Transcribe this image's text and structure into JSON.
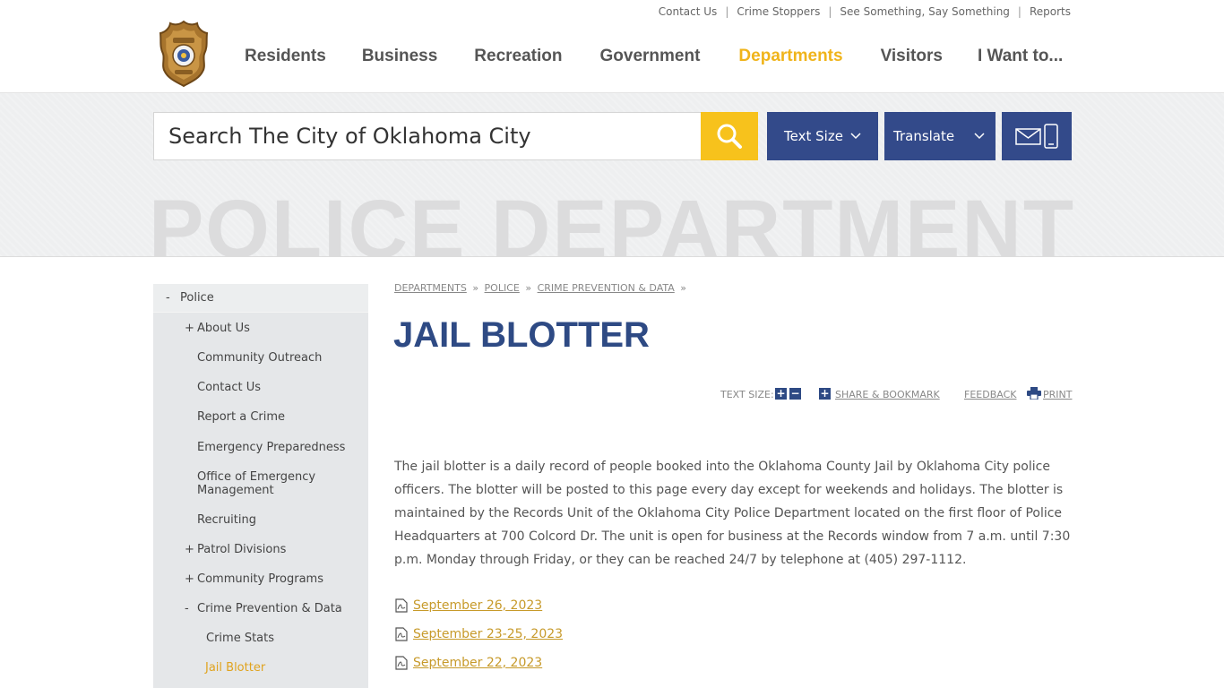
{
  "utility_nav": [
    "Contact Us",
    "Crime Stoppers",
    "See Something, Say Something",
    "Reports"
  ],
  "utility_sep": "|",
  "main_nav": [
    {
      "label": "Residents"
    },
    {
      "label": "Business"
    },
    {
      "label": "Recreation"
    },
    {
      "label": "Government"
    },
    {
      "label": "Departments",
      "active": true
    },
    {
      "label": "Visitors"
    },
    {
      "label": "I Want to..."
    }
  ],
  "search": {
    "placeholder": "Search The City of Oklahoma City"
  },
  "buttons": {
    "text_size": "Text Size",
    "translate": "Translate"
  },
  "banner_title": "POLICE DEPARTMENT",
  "sidebar": {
    "top": {
      "marker": "-",
      "label": "Police"
    },
    "items": [
      {
        "marker": "+",
        "label": "About Us"
      },
      {
        "marker": "",
        "label": "Community Outreach"
      },
      {
        "marker": "",
        "label": "Contact Us"
      },
      {
        "marker": "",
        "label": "Report a Crime"
      },
      {
        "marker": "",
        "label": "Emergency Preparedness"
      },
      {
        "marker": "",
        "label": "Office of Emergency Management"
      },
      {
        "marker": "",
        "label": "Recruiting"
      },
      {
        "marker": "+",
        "label": "Patrol Divisions"
      },
      {
        "marker": "+",
        "label": "Community Programs"
      },
      {
        "marker": "-",
        "label": "Crime Prevention & Data"
      },
      {
        "marker": "",
        "label": "Crime Stats"
      },
      {
        "marker": "",
        "label": "Jail Blotter",
        "current": true
      }
    ]
  },
  "breadcrumbs": [
    "DEPARTMENTS",
    "POLICE",
    "CRIME PREVENTION & DATA"
  ],
  "breadcrumb_sep": "»",
  "page_title": "JAIL BLOTTER",
  "tools": {
    "text_size": "TEXT SIZE:",
    "plus": "+",
    "minus": "−",
    "share": "SHARE & BOOKMARK",
    "feedback": "FEEDBACK",
    "print": "PRINT"
  },
  "intro": "The jail blotter is a daily record of people booked into the Oklahoma County Jail by Oklahoma City police officers. The blotter will be posted to this page every day except for weekends and holidays. The blotter is maintained by the Records Unit of the Oklahoma City Police Department located on the first floor of Police Headquarters at 700 Colcord Dr. The unit is open for business at the Records window from 7 a.m. until 7:30 p.m. Monday through Friday, or they can be reached 24/7 by telephone at (405) 297-1112.",
  "documents": [
    "September 26, 2023",
    "September 23-25, 2023",
    "September 22, 2023"
  ],
  "colors": {
    "navy": "#2e4a84",
    "gold": "#f0b41b",
    "search_yellow": "#f7c21c",
    "link_gold": "#c79a2a"
  }
}
